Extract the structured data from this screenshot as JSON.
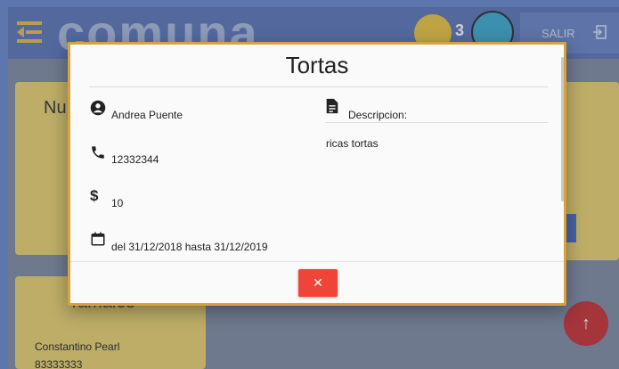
{
  "header": {
    "logo_text": "comuna",
    "coin_count": "3",
    "logout_label": "SALIR"
  },
  "background": {
    "card1_title": "Nu",
    "card3_title": "Tamales",
    "card3_person": "Constantino Pearl",
    "card3_phone": "83333333"
  },
  "modal": {
    "title": "Tortas",
    "owner": "Andrea Puente",
    "phone": "12332344",
    "price": "10",
    "dates": "del 31/12/2018 hasta 31/12/2019",
    "description_label": "Descripcion:",
    "description_text": "ricas tortas",
    "close_label": "✕"
  },
  "colors": {
    "accent": "#d7a23b",
    "close_button": "#f04438",
    "fab": "#c62f2f"
  }
}
